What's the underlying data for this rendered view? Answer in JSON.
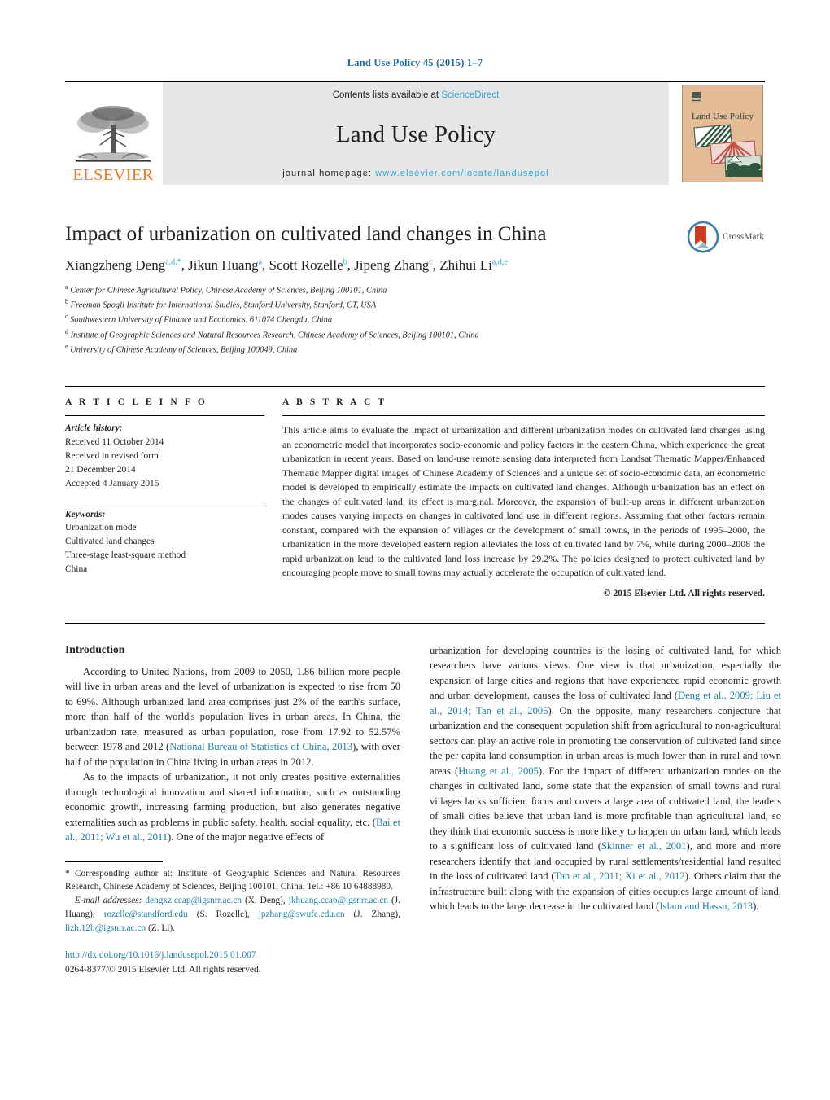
{
  "running_head": "Land Use Policy 45 (2015) 1–7",
  "masthead": {
    "publisher": "ELSEVIER",
    "contents_prefix": "Contents lists available at ",
    "contents_link": "ScienceDirect",
    "journal_title": "Land Use Policy",
    "homepage_prefix": "journal homepage: ",
    "homepage_url": "www.elsevier.com/locate/landusepol",
    "cover_title": "Land Use Policy",
    "cover_bg_color": "#e3bb96",
    "link_color": "#2ba6de",
    "elsevier_color": "#f47920"
  },
  "article": {
    "title": "Impact of urbanization on cultivated land changes in China",
    "authors_html": "Xiangzheng Deng<sup>a,d,</sup><sup>*</sup>, Jikun Huang<sup>a</sup>, Scott Rozelle<sup>b</sup>, Jipeng Zhang<sup>c</sup>, Zhihui Li<sup>a,d,e</sup>",
    "crossmark_label": "CrossMark",
    "affiliations": [
      "Center for Chinese Agricultural Policy, Chinese Academy of Sciences, Beijing 100101, China",
      "Freeman Spogli Institute for International Studies, Stanford University, Stanford, CT, USA",
      "Southwestern University of Finance and Economics, 611074 Chengdu, China",
      "Institute of Geographic Sciences and Natural Resources Research, Chinese Academy of Sciences, Beijing 100101, China",
      "University of Chinese Academy of Sciences, Beijing 100049, China"
    ],
    "affiliation_marks": [
      "a",
      "b",
      "c",
      "d",
      "e"
    ]
  },
  "article_info": {
    "heading": "A R T I C L E   I N F O",
    "history_label": "Article history:",
    "history": [
      "Received 11 October 2014",
      "Received in revised form",
      "21 December 2014",
      "Accepted 4 January 2015"
    ],
    "keywords_label": "Keywords:",
    "keywords": [
      "Urbanization mode",
      "Cultivated land changes",
      "Three-stage least-square method",
      "China"
    ]
  },
  "abstract": {
    "heading": "A B S T R A C T",
    "text": "This article aims to evaluate the impact of urbanization and different urbanization modes on cultivated land changes using an econometric model that incorporates socio-economic and policy factors in the eastern China, which experience the great urbanization in recent years. Based on land-use remote sensing data interpreted from Landsat Thematic Mapper/Enhanced Thematic Mapper digital images of Chinese Academy of Sciences and a unique set of socio-economic data, an econometric model is developed to empirically estimate the impacts on cultivated land changes. Although urbanization has an effect on the changes of cultivated land, its effect is marginal. Moreover, the expansion of built-up areas in different urbanization modes causes varying impacts on changes in cultivated land use in different regions. Assuming that other factors remain constant, compared with the expansion of villages or the development of small towns, in the periods of 1995–2000, the urbanization in the more developed eastern region alleviates the loss of cultivated land by 7%, while during 2000–2008 the rapid urbanization lead to the cultivated land loss increase by 29.2%. The policies designed to protect cultivated land by encouraging people move to small towns may actually accelerate the occupation of cultivated land.",
    "copyright": "© 2015 Elsevier Ltd. All rights reserved."
  },
  "introduction": {
    "heading": "Introduction",
    "left_paragraphs": [
      {
        "segments": [
          {
            "t": "According to United Nations, from 2009 to 2050, 1.86 billion more people will live in urban areas and the level of urbanization is expected to rise from 50 to 69%. Although urbanized land area comprises just 2% of the earth's surface, more than half of the world's population lives in urban areas. In China, the urbanization rate, measured as urban population, rose from 17.92 to 52.57% between 1978 and 2012 ("
          },
          {
            "t": "National Bureau of Statistics of China, 2013",
            "ref": true
          },
          {
            "t": "), with over half of the population in China living in urban areas in 2012."
          }
        ]
      },
      {
        "segments": [
          {
            "t": "As to the impacts of urbanization, it not only creates positive externalities through technological innovation and shared information, such as outstanding economic growth, increasing farming production, but also generates negative externalities such as problems in public safety, health, social equality, etc. ("
          },
          {
            "t": "Bai et al., 2011; Wu et al., 2011",
            "ref": true
          },
          {
            "t": "). One of the major negative effects of"
          }
        ]
      }
    ],
    "right_paragraphs": [
      {
        "continuation": true,
        "segments": [
          {
            "t": "urbanization for developing countries is the losing of cultivated land, for which researchers have various views. One view is that urbanization, especially the expansion of large cities and regions that have experienced rapid economic growth and urban development, causes the loss of cultivated land ("
          },
          {
            "t": "Deng et al., 2009; Liu et al., 2014; Tan et al., 2005",
            "ref": true
          },
          {
            "t": "). On the opposite, many researchers conjecture that urbanization and the consequent population shift from agricultural to non-agricultural sectors can play an active role in promoting the conservation of cultivated land since the per capita land consumption in urban areas is much lower than in rural and town areas ("
          },
          {
            "t": "Huang et al., 2005",
            "ref": true
          },
          {
            "t": "). For the impact of different urbanization modes on the changes in cultivated land, some state that the expansion of small towns and rural villages lacks sufficient focus and covers a large area of cultivated land, the leaders of small cities believe that urban land is more profitable than agricultural land, so they think that economic success is more likely to happen on urban land, which leads to a significant loss of cultivated land ("
          },
          {
            "t": "Skinner et al., 2001",
            "ref": true
          },
          {
            "t": "), and more and more researchers identify that land occupied by rural settlements/residential land resulted in the loss of cultivated land ("
          },
          {
            "t": "Tan et al., 2011; Xi et al., 2012",
            "ref": true
          },
          {
            "t": "). Others claim that the infrastructure built along with the expansion of cities occupies large amount of land, which leads to the large decrease in the cultivated land ("
          },
          {
            "t": "Islam and Hassn, 2013",
            "ref": true
          },
          {
            "t": ")."
          }
        ]
      }
    ]
  },
  "footnotes": {
    "corresponding": [
      {
        "t": "* Corresponding author at: Institute of Geographic Sciences and Natural Resources Research, Chinese Academy of Sciences, Beijing 100101, China. Tel.: +86 10 64888980."
      }
    ],
    "email_label": "E-mail addresses:",
    "emails": [
      {
        "address": "dengxz.ccap@igsnrr.ac.cn",
        "who": "(X. Deng),"
      },
      {
        "address": "jkhuang.ccap@igsnrr.ac.cn",
        "who": "(J. Huang),"
      },
      {
        "address": "rozelle@standford.edu",
        "who": "(S. Rozelle),"
      },
      {
        "address": "jpzhang@swufe.edu.cn",
        "who": "(J. Zhang),"
      },
      {
        "address": "lizh.12b@igsnrr.ac.cn",
        "who": "(Z. Li)."
      }
    ],
    "doi": "http://dx.doi.org/10.1016/j.landusepol.2015.01.007",
    "issn": "0264-8377/© 2015 Elsevier Ltd. All rights reserved."
  }
}
